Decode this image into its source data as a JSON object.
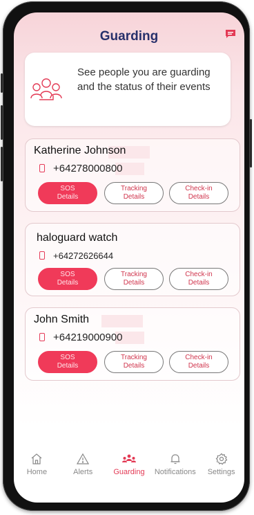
{
  "header": {
    "title": "Guarding"
  },
  "info": {
    "text": "See people you are guarding and the status of their events"
  },
  "persons": [
    {
      "name": "Katherine Johnson",
      "phone": "+64278000800"
    },
    {
      "name": "haloguard watch",
      "phone": "+64272626644"
    },
    {
      "name": "John Smith",
      "phone": "+64219000900"
    }
  ],
  "actions": {
    "sos": "SOS\nDetails",
    "tracking": "Tracking\nDetails",
    "checkin": "Check-in\nDetails"
  },
  "nav": {
    "home": "Home",
    "alerts": "Alerts",
    "guarding": "Guarding",
    "notifications": "Notifications",
    "settings": "Settings"
  },
  "colors": {
    "accent": "#f03a59",
    "title": "#27306b"
  },
  "icons": [
    "chat-icon",
    "people-icon",
    "phone-icon",
    "home-icon",
    "alert-icon",
    "guarding-icon",
    "bell-icon",
    "gear-icon"
  ]
}
